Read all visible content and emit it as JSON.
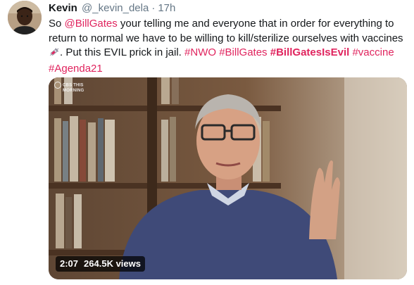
{
  "tweet": {
    "author_name": "Kevin",
    "handle": "@_kevin_dela",
    "separator": "·",
    "time": "17h",
    "text": {
      "p1": "So ",
      "mention": "@BillGates",
      "p2": " your telling me and everyone that in order for everything to return to normal we have to be willing to kill/sterilize ourselves with vaccines ",
      "p3": ". Put this EVIL prick in jail. ",
      "tag_nwo": "#NWO",
      "tag_billgates": "#BillGates",
      "tag_billgatesisevil": "#BillGatesIsEvil",
      "tag_vaccine": "#vaccine",
      "tag_agenda21": "#Agenda21"
    },
    "colors": {
      "link": "#e0245e",
      "muted": "#657786",
      "text": "#14171a"
    }
  },
  "video": {
    "duration": "2:07",
    "views": "264.5K views",
    "watermark_line1": "CBS THIS",
    "watermark_line2": "MORNING"
  }
}
